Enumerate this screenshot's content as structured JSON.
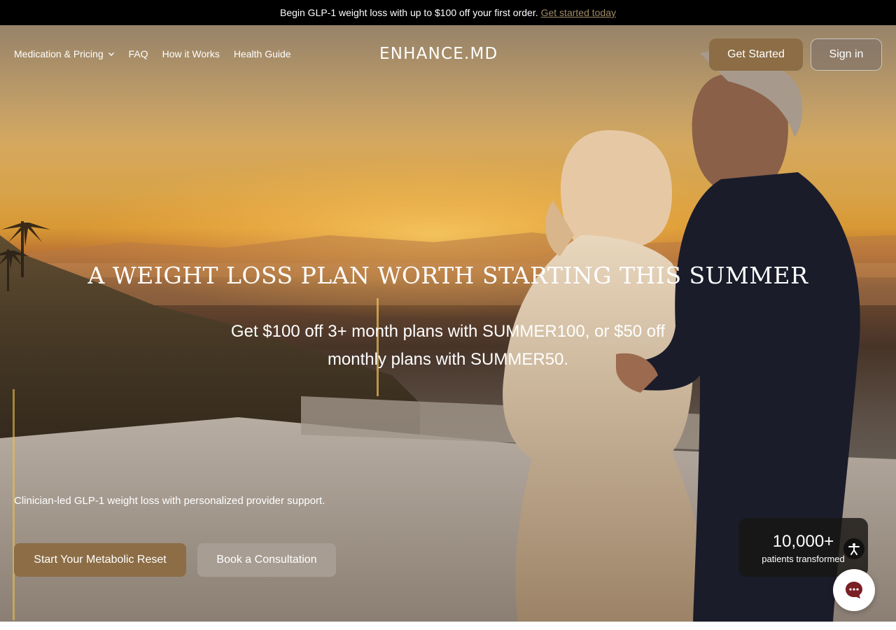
{
  "promo": {
    "text": "Begin GLP-1 weight loss with up to $100 off your first order.",
    "link": "Get started today"
  },
  "nav": {
    "items": [
      {
        "label": "Medication & Pricing",
        "has_dropdown": true,
        "icon": "chevron-down-icon"
      },
      {
        "label": "FAQ"
      },
      {
        "label": "How it Works"
      },
      {
        "label": "Health Guide"
      }
    ],
    "logo": "ENHANCE.MD",
    "get_started": "Get Started",
    "sign_in": "Sign in"
  },
  "hero": {
    "headline": "A WEIGHT LOSS PLAN WORTH STARTING THIS SUMMER",
    "subhead": "Get $100 off 3+ month plans with SUMMER100, or $50 off monthly plans with SUMMER50.",
    "tagline": "Clinician-led GLP-1 weight loss with personalized provider support.",
    "primary_cta": "Start Your Metabolic Reset",
    "secondary_cta": "Book a Consultation"
  },
  "stats": {
    "number": "10,000+",
    "label": "patients transformed"
  },
  "widgets": {
    "accessibility_icon": "accessibility-icon",
    "chat_icon": "chat-bubble-icon"
  },
  "colors": {
    "accent": "#8c6d45",
    "promo_link": "#a08a64",
    "promo_bg": "#000000",
    "chat_icon": "#7a1f24"
  }
}
